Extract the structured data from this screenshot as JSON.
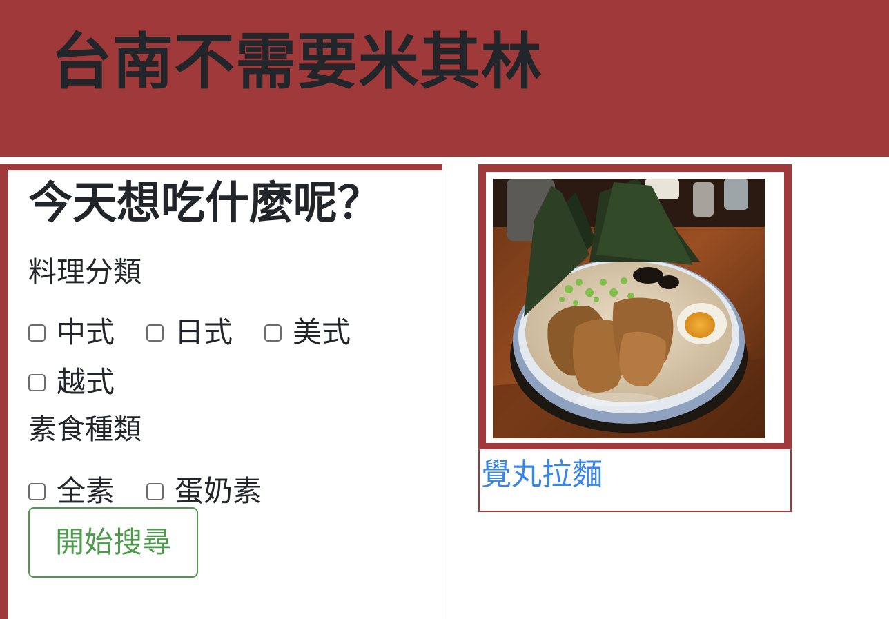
{
  "header": {
    "title": "台南不需要米其林"
  },
  "search": {
    "title": "今天想吃什麼呢？",
    "cuisine": {
      "label": "料理分類",
      "options": [
        {
          "label": "中式",
          "checked": false
        },
        {
          "label": "日式",
          "checked": false
        },
        {
          "label": "美式",
          "checked": false
        },
        {
          "label": "越式",
          "checked": false
        }
      ]
    },
    "vegetarian": {
      "label": "素食種類",
      "options": [
        {
          "label": "全素",
          "checked": false
        },
        {
          "label": "蛋奶素",
          "checked": false
        }
      ]
    },
    "button_label": "開始搜尋"
  },
  "results": [
    {
      "name": "覺丸拉麵",
      "image": "ramen-bowl-photo"
    }
  ],
  "colors": {
    "brand": "#a0393a",
    "button": "#4e9a4c",
    "link": "#3a86e8"
  }
}
